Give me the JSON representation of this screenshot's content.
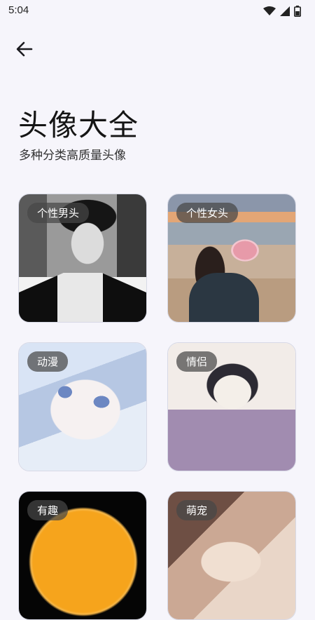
{
  "status_bar": {
    "time": "5:04",
    "icons": [
      "wifi-icon",
      "signal-icon",
      "battery-icon"
    ]
  },
  "header": {
    "back_icon": "arrow-left-icon",
    "title": "头像大全",
    "subtitle": "多种分类高质量头像"
  },
  "categories": [
    {
      "label": "个性男头"
    },
    {
      "label": "个性女头"
    },
    {
      "label": "动漫"
    },
    {
      "label": "情侣"
    },
    {
      "label": "有趣"
    },
    {
      "label": "萌宠"
    }
  ],
  "colors": {
    "background": "#f6f5fb",
    "label_bg": "#464646",
    "text": "#1b1b1f"
  }
}
